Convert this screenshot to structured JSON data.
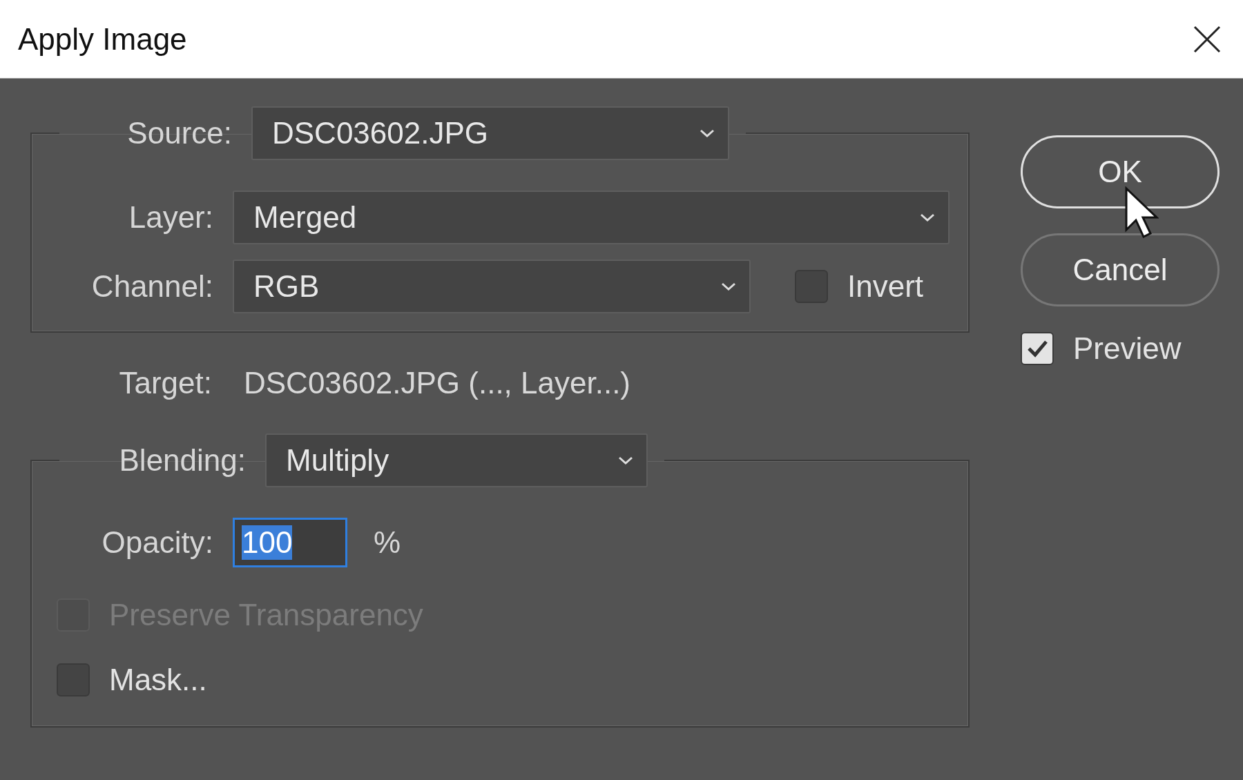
{
  "window": {
    "title": "Apply Image"
  },
  "source": {
    "label": "Source:",
    "value": "DSC03602.JPG"
  },
  "layer": {
    "label": "Layer:",
    "value": "Merged"
  },
  "channel": {
    "label": "Channel:",
    "value": "RGB"
  },
  "invert": {
    "label": "Invert",
    "checked": false
  },
  "target": {
    "label": "Target:",
    "value": "DSC03602.JPG (..., Layer...)"
  },
  "blending": {
    "label": "Blending:",
    "value": "Multiply"
  },
  "opacity": {
    "label": "Opacity:",
    "value": "100",
    "unit": "%",
    "text_selected": true
  },
  "preserve_transparency": {
    "label": "Preserve Transparency",
    "checked": false,
    "disabled": true
  },
  "mask": {
    "label": "Mask...",
    "checked": false,
    "disabled": false
  },
  "buttons": [
    {
      "label": "OK",
      "default": true
    },
    {
      "label": "Cancel",
      "default": false
    }
  ],
  "preview": {
    "label": "Preview",
    "checked": true
  }
}
